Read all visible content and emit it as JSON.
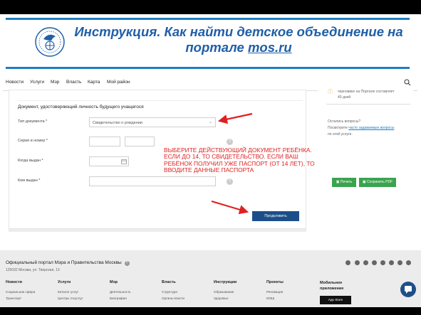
{
  "slide": {
    "title_part1": "Инструкция. Как найти детское объединение на портале ",
    "title_link": "mos.ru"
  },
  "nav": {
    "items": [
      "Новости",
      "Услуги",
      "Мэр",
      "Власть",
      "Карта",
      "Мой район"
    ]
  },
  "form": {
    "section_title": "Документ, удостоверяющий личность будущего учащегося",
    "doc_type_label": "Тип документа *",
    "doc_type_value": "Свидетельство о рождении",
    "series_label": "Серия и номер *",
    "issued_when_label": "Когда выдан *",
    "issued_by_label": "Кем выдан *",
    "submit_label": "Продолжить"
  },
  "annotation": {
    "text": "Выберите действующий документ ребёнка. Если до 14, то свидетельство. Если ваш ребёнок получил уже паспорт (от 14 лет), то вводите данные паспорта",
    "color": "#e02020"
  },
  "sidebar": {
    "line1": "черновике на Портале составляет",
    "line2": "40 дней",
    "q": "Остались вопросы?",
    "see": "Посмотрите",
    "see_link": "часто задаваемые вопросы",
    "see_end": "по этой услуге.",
    "print_label": "Печать",
    "pdf_label": "Сохранить PDF"
  },
  "footer": {
    "title": "Официальный портал Мэра и Правительства Москвы",
    "address": "125032 Москва, ул. Тверская, 13",
    "columns": [
      {
        "title": "Новости",
        "items": [
          "Социальная сфера",
          "Транспорт"
        ]
      },
      {
        "title": "Услуги",
        "items": [
          "Каталог услуг",
          "Центры госуслуг"
        ]
      },
      {
        "title": "Мэр",
        "items": [
          "Деятельность",
          "Биография"
        ]
      },
      {
        "title": "Власть",
        "items": [
          "Структура",
          "Органы власти"
        ]
      },
      {
        "title": "Инструкции",
        "items": [
          "Образование",
          "Здоровье"
        ]
      },
      {
        "title": "Проекты",
        "items": [
          "Реновация",
          "МЭШ"
        ]
      },
      {
        "title": "Мобильное приложение",
        "items": []
      }
    ],
    "appstore_label": "App Store"
  }
}
